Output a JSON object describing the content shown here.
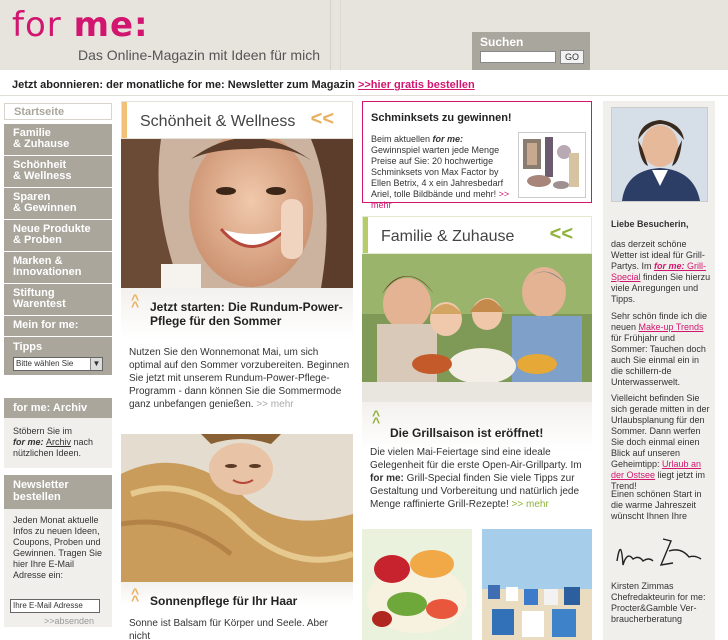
{
  "header": {
    "logo_for": "for ",
    "logo_me": "me:",
    "tagline": "Das Online-Magazin mit Ideen für mich",
    "search_label": "Suchen",
    "search_go": "GO"
  },
  "newsletter_bar": {
    "text": "Jetzt abonnieren: der monatliche for me: Newsletter zum Magazin ",
    "link": ">>hier gratis bestellen"
  },
  "nav": {
    "items": [
      {
        "label": "Startseite"
      },
      {
        "label": "Familie\n& Zuhause"
      },
      {
        "label": "Schönheit\n& Wellness"
      },
      {
        "label": "Sparen\n& Gewinnen"
      },
      {
        "label": "Neue Produkte\n& Proben"
      },
      {
        "label": "Marken &\nInnovationen"
      },
      {
        "label": "Stiftung\nWarentest"
      },
      {
        "label": "Mein for me:"
      }
    ],
    "tipps_label": "Tipps",
    "tipps_select": "Bitte wählen Sie",
    "archiv_head": "for me: Archiv",
    "archiv_text_1": "Stöbern Sie im",
    "archiv_text_2a": "for me: ",
    "archiv_text_2b": "Archiv",
    "archiv_text_2c": " nach",
    "archiv_text_3": "nützlichen Ideen.",
    "newsletter_head": "Newsletter\nbestellen",
    "newsletter_text": "Jeden Monat aktuelle Infos zu neuen Ideen, Coupons, Proben und Gewinnen. Tragen Sie hier Ihre E-Mail Adresse ein:",
    "newsletter_input": "Ihre E-Mail Adresse",
    "newsletter_send": ">>absenden"
  },
  "beauty": {
    "head": "Schönheit & Wellness",
    "chev": "<<",
    "article1_title": "Jetzt starten: Die Rundum-Power-Pflege für den Sommer",
    "article1_text": "Nutzen Sie den Wonnemonat Mai, um sich optimal auf den Sommer vorzubereiten. Beginnen Sie jetzt mit unserem Rundum-Power-Pflege-Programm - dann können Sie die Sommermode ganz unbefangen genießen.",
    "more": ">> mehr",
    "article2_title": "Sonnenpflege für Ihr Haar",
    "article2_text": "Sonne ist Balsam für Körper und Seele. Aber nicht"
  },
  "promo": {
    "title": "Schminksets zu gewinnen!",
    "text_1": "Beim aktuellen ",
    "text_em": "for me:",
    "text_2": " Gewinnspiel warten jede Menge Preise auf Sie: 20 hochwertige Schminksets von Max Factor by Ellen Betrix, 4 x ein Jahresbedarf Ariel, tolle Bildbände und mehr! ",
    "more": ">> mehr"
  },
  "family": {
    "head": "Familie & Zuhause",
    "chev": "<<",
    "article_title": "Die Grillsaison ist eröffnet!",
    "article_text_1": "Die vielen Mai-Feiertage sind eine ideale Gelegenheit für die erste Open-Air-Grillparty. Im ",
    "article_text_em": "for me:",
    "article_text_2": " Grill-Special finden Sie viele Tipps zur Gestaltung und Vorbereitung und natürlich jede Menge raffinierte Grill-Rezepte! ",
    "more": ">> mehr"
  },
  "editor": {
    "greeting": "Liebe Besucherin,",
    "p1_a": "das derzeit schöne Wetter ist ideal für Grill-Partys. Im ",
    "p1_link_em": "for me:",
    "p1_link": " Grill-Special",
    "p1_b": " finden Sie hierzu viele Anregungen und Tipps.",
    "p2_a": "Sehr schön finde ich die neuen ",
    "p2_link": "Make-up Trends",
    "p2_b": " für Frühjahr und Sommer: Tauchen doch auch Sie einmal ein in die schillern-de Unterwasserwelt.",
    "p3_a": "Vielleicht befinden Sie sich gerade mitten in der Urlaubsplanung für den Sommer. Dann werfen Sie doch einmal einen Blick auf unseren Geheimtipp: ",
    "p3_link": "Urlaub an der Ostsee",
    "p3_b": " liegt jetzt im Trend!",
    "p4": "Einen schönen Start in die warme Jahreszeit wünscht Ihnen Ihre",
    "signature": "Kirsten Zimmas",
    "sign_name": "Kirsten Zimmas",
    "sign_role": "Chefredakteurin for me: Procter&Gamble Ver-braucherberatung"
  }
}
